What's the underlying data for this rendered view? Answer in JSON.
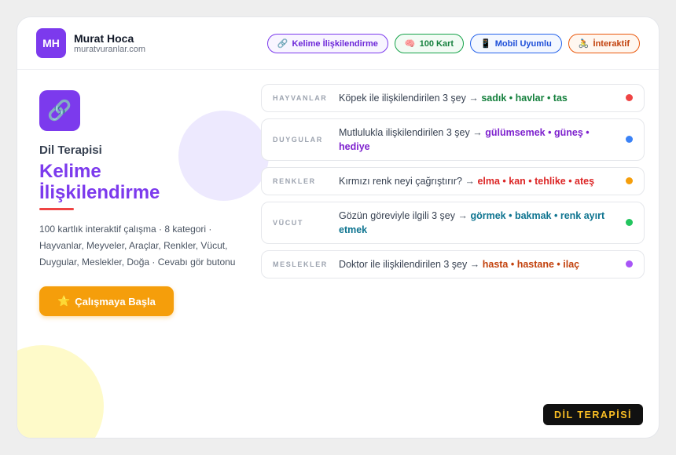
{
  "author": {
    "initials": "MH",
    "name": "Murat Hoca",
    "site": "muratvuranlar.com"
  },
  "badges": [
    {
      "icon": "🔗",
      "icon_name": "link-icon",
      "label": "Kelime İlişkilendirme",
      "color": "#7c3aed"
    },
    {
      "icon": "🧠",
      "icon_name": "brain-icon",
      "label": "100 Kart",
      "color": "#16a34a"
    },
    {
      "icon": "📱",
      "icon_name": "mobile-icon",
      "label": "Mobil Uyumlu",
      "color": "#2563eb"
    },
    {
      "icon": "🚴",
      "icon_name": "cyclist-icon",
      "label": "İnteraktif",
      "color": "#ea580c"
    }
  ],
  "hero": {
    "icon": "🔗",
    "icon_name": "link-icon",
    "eyebrow": "Dil Terapisi",
    "title_line1": "Kelime",
    "title_line2": "İlişkilendirme",
    "description": "100 kartlık interaktif çalışma · 8 kategori · Hayvanlar, Meyveler, Araçlar, Renkler, Vücut, Duygular, Meslekler, Doğa · Cevabı gör butonu",
    "cta_icon": "⭐",
    "cta_icon_name": "star-icon",
    "cta_label": "Çalışmaya Başla",
    "accent_color": "#7c3aed"
  },
  "cards": [
    {
      "category": "HAYVANLAR",
      "prompt": "Köpek ile ilişkilendirilen 3 şey",
      "arrow": "→",
      "answers": "sadık • havlar • tas",
      "answer_color": "#15803d",
      "dot_color": "#ef4444"
    },
    {
      "category": "DUYGULAR",
      "prompt": "Mutlulukla ilişkilendirilen 3 şey",
      "arrow": "→",
      "answers": "gülümsemek • güneş • hediye",
      "answer_color": "#7e22ce",
      "dot_color": "#3b82f6"
    },
    {
      "category": "RENKLER",
      "prompt": "Kırmızı renk neyi çağrıştırır?",
      "arrow": "→",
      "answers": "elma • kan • tehlike • ateş",
      "answer_color": "#dc2626",
      "dot_color": "#f59e0b"
    },
    {
      "category": "VÜCUT",
      "prompt": "Gözün göreviyle ilgili 3 şey",
      "arrow": "→",
      "answers": "görmek • bakmak • renk ayırt etmek",
      "answer_color": "#0e7490",
      "dot_color": "#22c55e"
    },
    {
      "category": "MESLEKLER",
      "prompt": "Doktor ile ilişkilendirilen 3 şey",
      "arrow": "→",
      "answers": "hasta • hastane • ilaç",
      "answer_color": "#c2410c",
      "dot_color": "#a855f7"
    }
  ],
  "footer_tag": "DİL TERAPİSİ"
}
